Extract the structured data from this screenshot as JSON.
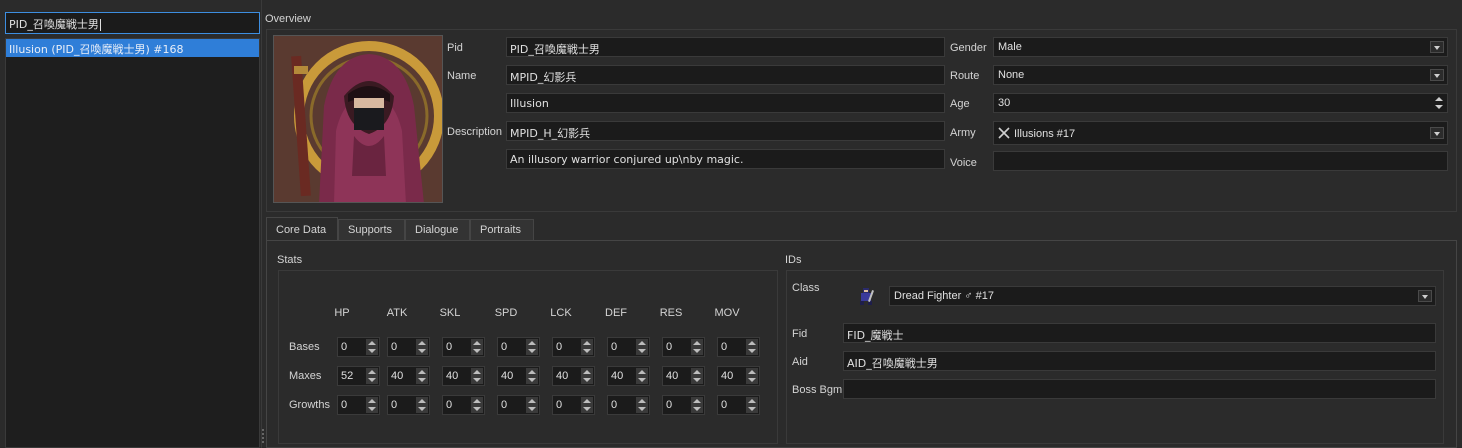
{
  "search": {
    "value": "PID_召喚魔戦士男"
  },
  "list": {
    "items": [
      {
        "label": "Illusion (PID_召喚魔戦士男) #168",
        "selected": true
      }
    ]
  },
  "overview": {
    "title": "Overview",
    "pid_label": "Pid",
    "pid": "PID_召喚魔戦士男",
    "name_label": "Name",
    "name": "MPID_幻影兵",
    "display_name": "Illusion",
    "description_label": "Description",
    "description": "MPID_H_幻影兵",
    "description_text": "An illusory warrior conjured up\\nby magic.",
    "gender_label": "Gender",
    "gender": "Male",
    "route_label": "Route",
    "route": "None",
    "age_label": "Age",
    "age": "30",
    "army_label": "Army",
    "army": "Illusions #17",
    "army_icon": "crossed-swords-icon",
    "voice_label": "Voice",
    "voice": ""
  },
  "tabs": [
    {
      "label": "Core Data",
      "active": true
    },
    {
      "label": "Supports",
      "active": false
    },
    {
      "label": "Dialogue",
      "active": false
    },
    {
      "label": "Portraits",
      "active": false
    }
  ],
  "stats": {
    "title": "Stats",
    "columns": [
      "HP",
      "ATK",
      "SKL",
      "SPD",
      "LCK",
      "DEF",
      "RES",
      "MOV"
    ],
    "rows": [
      {
        "label": "Bases",
        "values": [
          "0",
          "0",
          "0",
          "0",
          "0",
          "0",
          "0",
          "0"
        ]
      },
      {
        "label": "Maxes",
        "values": [
          "52",
          "40",
          "40",
          "40",
          "40",
          "40",
          "40",
          "40"
        ]
      },
      {
        "label": "Growths",
        "values": [
          "0",
          "0",
          "0",
          "0",
          "0",
          "0",
          "0",
          "0"
        ]
      }
    ]
  },
  "ids": {
    "title": "IDs",
    "class_label": "Class",
    "class": "Dread Fighter ♂ #17",
    "class_icon": "dread-fighter-sprite-icon",
    "fid_label": "Fid",
    "fid": "FID_魔戦士",
    "aid_label": "Aid",
    "aid": "AID_召喚魔戦士男",
    "boss_bgm_label": "Boss Bgm",
    "boss_bgm": ""
  },
  "colors": {
    "accent": "#2f7ed8",
    "background": "#2b2b2b",
    "field": "#1b1b1b"
  }
}
